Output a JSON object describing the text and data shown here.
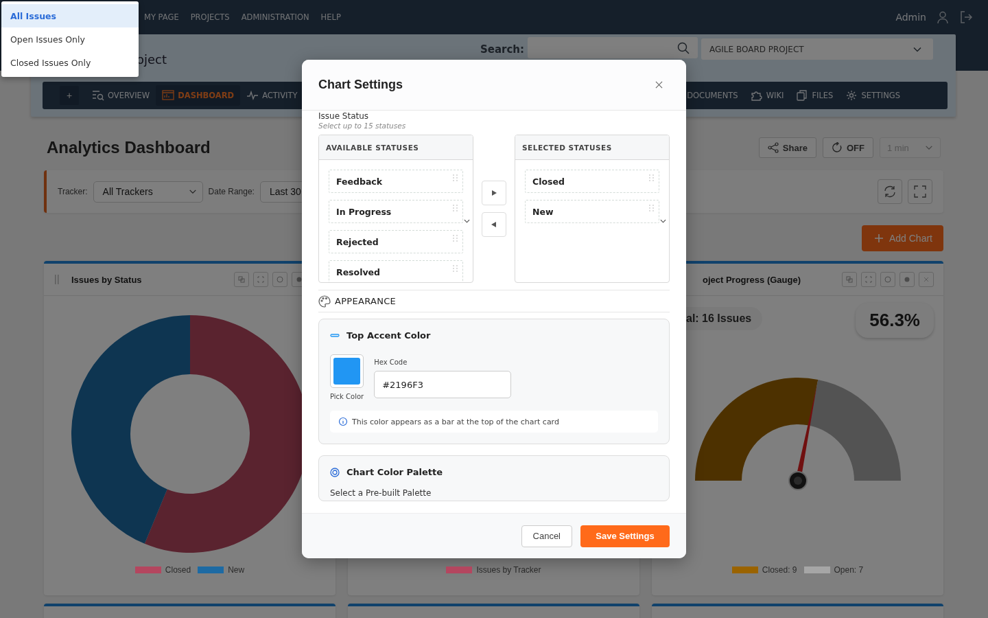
{
  "filter_menu": {
    "items": [
      {
        "label": "All Issues",
        "selected": true
      },
      {
        "label": "Open Issues Only",
        "selected": false
      },
      {
        "label": "Closed Issues Only",
        "selected": false
      }
    ]
  },
  "top_nav": {
    "links": [
      "MY PAGE",
      "PROJECTS",
      "ADMINISTRATION",
      "HELP"
    ],
    "user": "Admin"
  },
  "project_header": {
    "title": "oject",
    "search_label": "Search:",
    "project_select": "AGILE BOARD PROJECT",
    "add_button": "+",
    "tabs": [
      {
        "label": "OVERVIEW",
        "selected": false
      },
      {
        "label": "DASHBOARD",
        "selected": true
      },
      {
        "label": "ACTIVITY",
        "selected": false
      },
      {
        "label": "DOCUMENTS",
        "selected": false
      },
      {
        "label": "WIKI",
        "selected": false
      },
      {
        "label": "FILES",
        "selected": false
      },
      {
        "label": "SETTINGS",
        "selected": false
      }
    ]
  },
  "dashboard": {
    "title": "Analytics Dashboard",
    "share": "Share",
    "auto_refresh": "OFF",
    "interval": "1 min",
    "filters": {
      "tracker_label": "Tracker:",
      "tracker": "All Trackers",
      "date_label": "Date Range:",
      "date": "Last 30"
    },
    "add_chart": "Add Chart",
    "charts": [
      {
        "kind": "donut",
        "title": "Issues by Status",
        "legend": [
          {
            "label": "Closed",
            "color": "#b4465f"
          },
          {
            "label": "New",
            "color": "#1d6aa3"
          }
        ]
      },
      {
        "kind": "bar",
        "legend": [
          {
            "label": "Issues by Tracker",
            "color": "#b4465f"
          }
        ]
      },
      {
        "kind": "gauge",
        "title": "oject Progress (Gauge)",
        "total": "al: 16 Issues",
        "percent": "56.3%",
        "legend": [
          {
            "label": "Closed: 9",
            "color": "#9a6300"
          },
          {
            "label": "Open: 7",
            "color": "#a6a6a6"
          }
        ]
      }
    ]
  },
  "modal": {
    "title": "Chart Settings",
    "issue_status": {
      "label": "Issue Status",
      "hint": "Select up to 15 statuses",
      "available": {
        "heading": "AVAILABLE STATUSES",
        "items": [
          "Feedback",
          "In Progress",
          "Rejected",
          "Resolved"
        ]
      },
      "selected": {
        "heading": "SELECTED STATUSES",
        "items": [
          "Closed",
          "New"
        ]
      }
    },
    "appearance": "APPEARANCE",
    "accent": {
      "title": "Top Accent Color",
      "pick_label": "Pick Color",
      "hex_label": "Hex Code",
      "hex_value": "#2196F3",
      "color": "#2196f3",
      "note": "This color appears as a bar at the top of the chart card"
    },
    "palette": {
      "title": "Chart Color Palette",
      "subtitle": "Select a Pre-built Palette"
    },
    "cancel": "Cancel",
    "save": "Save Settings"
  }
}
